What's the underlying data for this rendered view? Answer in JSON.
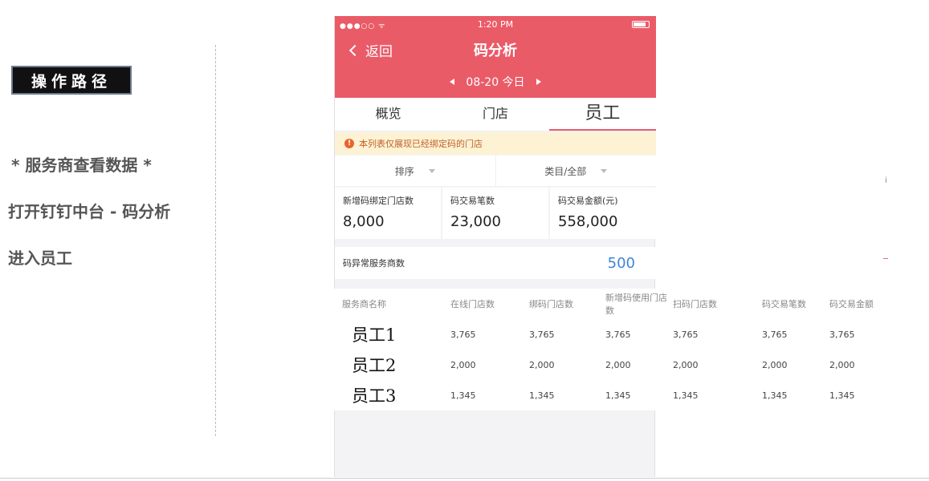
{
  "annotation": {
    "path_tag": "操作路径",
    "line1": "* 服务商查看数据 *",
    "line2": "打开钉钉中台 - 码分析",
    "line3": "进入员工"
  },
  "status_bar": {
    "signal": "●●●○○ ᯤ",
    "time": "1:20 PM"
  },
  "header": {
    "back_label": "返回",
    "title": "码分析",
    "date": "08-20 今日"
  },
  "tabs": [
    {
      "label": "概览"
    },
    {
      "label": "门店"
    },
    {
      "label": "员工"
    }
  ],
  "active_tab": "员工",
  "notice": {
    "icon": "!",
    "text": "本列表仅展现已经绑定码的门店"
  },
  "filters": {
    "sort": "排序",
    "category": "类目/全部"
  },
  "stats": [
    {
      "label": "新增码绑定门店数",
      "value": "8,000"
    },
    {
      "label": "码交易笔数",
      "value": "23,000"
    },
    {
      "label": "码交易金额(元)",
      "value": "558,000"
    }
  ],
  "abnormal": {
    "label": "码异常服务商数",
    "value": "500"
  },
  "table": {
    "headers": [
      "服务商名称",
      "在线门店数",
      "绑码门店数",
      "新增码使用门店数",
      "扫码门店数",
      "码交易笔数",
      "码交易金额"
    ],
    "rows": [
      {
        "name": "员工1",
        "cells": [
          "3,765",
          "3,765",
          "3,765",
          "3,765",
          "3,765",
          "3,765"
        ]
      },
      {
        "name": "员工2",
        "cells": [
          "2,000",
          "2,000",
          "2,000",
          "2,000",
          "2,000",
          "2,000"
        ]
      },
      {
        "name": "员工3",
        "cells": [
          "1,345",
          "1,345",
          "1,345",
          "1,345",
          "1,345",
          "1,345"
        ]
      }
    ]
  },
  "colors": {
    "header_bg": "#ea5b68",
    "tab_underline": "#ea5b68",
    "notice_bg": "#fdf2d4",
    "abnormal_value": "#3d86d6"
  }
}
